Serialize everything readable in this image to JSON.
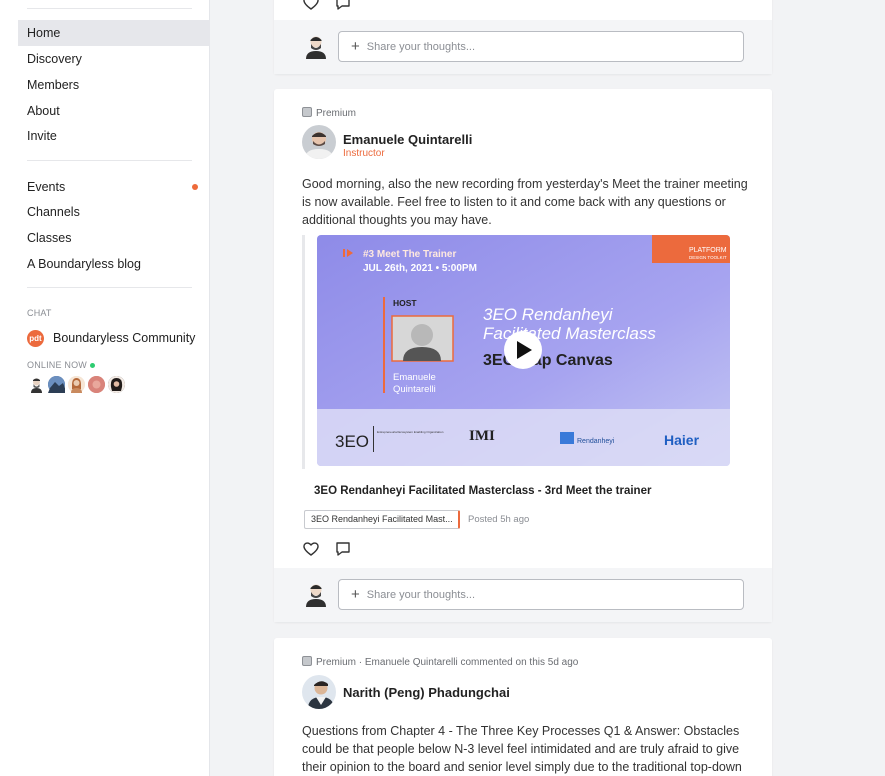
{
  "sidebar": {
    "nav": [
      {
        "label": "Home",
        "active": true
      },
      {
        "label": "Discovery"
      },
      {
        "label": "Members"
      },
      {
        "label": "About"
      },
      {
        "label": "Invite"
      }
    ],
    "sections": [
      {
        "label": "Events",
        "has_dot": true
      },
      {
        "label": "Channels"
      },
      {
        "label": "Classes"
      },
      {
        "label": "A Boundaryless blog"
      }
    ],
    "chat_caption": "CHAT",
    "community_logo_text": "pdt",
    "community_name": "Boundaryless Community",
    "online_caption": "ONLINE NOW",
    "online_avatar_colors": [
      "#3a3a3a",
      "#3b5c8a",
      "#c98a5e",
      "#d38a7a",
      "#2a2221"
    ]
  },
  "feed": {
    "reply_placeholder": "Share your thoughts...",
    "post": {
      "badge": "Premium",
      "author": "Emanuele Quintarelli",
      "role": "Instructor",
      "text": "Good morning, also the new recording from yesterday's Meet the trainer meeting is now available. Feel free to listen to it and come back with any questions or additional thoughts you may have.",
      "media": {
        "series": "#3 Meet The Trainer",
        "date": "JUL 26th, 2021 • 5:00PM",
        "corner_tag": "PLATFORM",
        "corner_sub": "DESIGN TOOLKIT",
        "host_label": "HOST",
        "host_name_1": "Emanuele",
        "host_name_2": "Quintarelli",
        "headline_1": "3EO Rendanheyi",
        "headline_2": "Facilitated Masterclass",
        "headline_3": "3EO Map Canvas",
        "logo_1": "3EO",
        "logo_1_text": "Entrepreneurial Ecosystem Enabling Organization",
        "logo_2": "IMI",
        "logo_3": "Rendanheyi",
        "logo_4": "Haier"
      },
      "media_title": "3EO Rendanheyi Facilitated Masterclass - 3rd Meet the trainer",
      "tag": "3EO Rendanheyi Facilitated Mast...",
      "posted": "Posted 5h ago"
    },
    "post2": {
      "meta": "Premium · Emanuele Quintarelli commented on this 5d ago",
      "author": "Narith (Peng) Phadungchai",
      "text": "Questions from Chapter 4 - The Three Key Processes Q1 & Answer: Obstacles could be that people below N-3 level feel intimidated and are truly afraid to give their opinion to the board and senior level simply due to the traditional top-down"
    }
  }
}
